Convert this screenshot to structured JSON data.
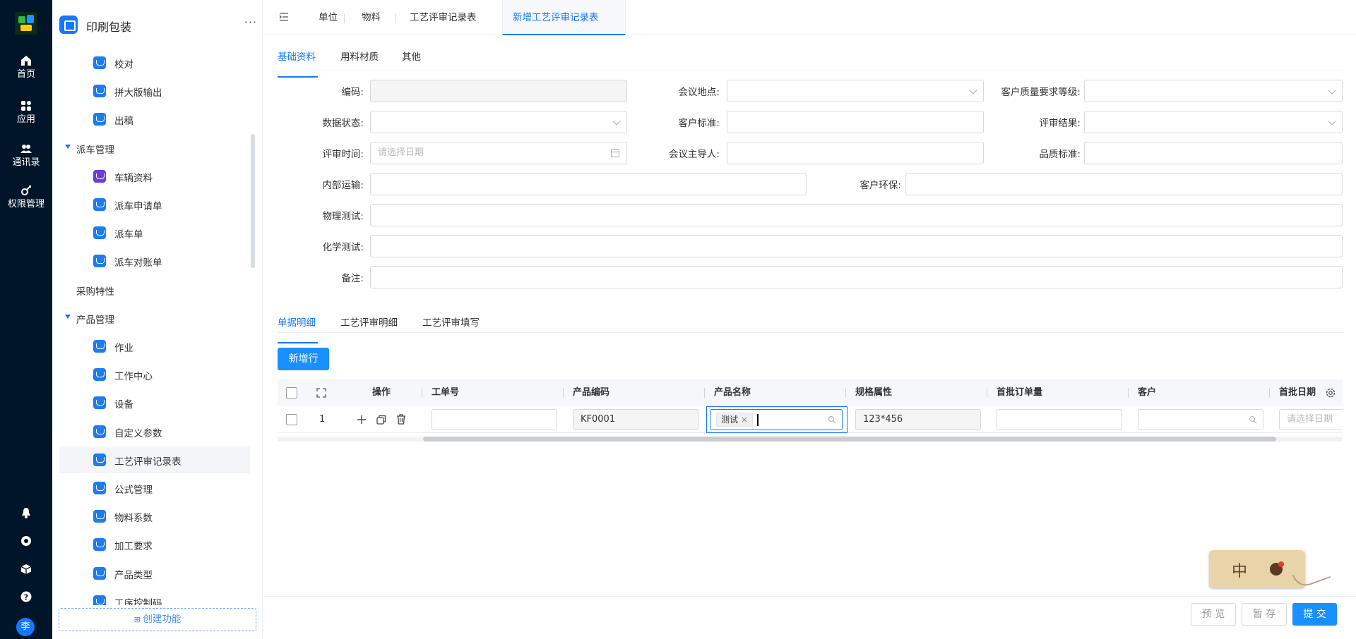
{
  "rail": {
    "items": [
      {
        "label": "首页",
        "icon": "home-icon"
      },
      {
        "label": "应用",
        "icon": "apps-icon"
      },
      {
        "label": "通讯录",
        "icon": "contacts-icon"
      },
      {
        "label": "权限管理",
        "icon": "key-icon"
      }
    ],
    "bottom_icons": [
      "bell-icon",
      "settings-icon",
      "cube-icon",
      "help-icon"
    ],
    "avatar": "李"
  },
  "sidebar": {
    "title": "印刷包装",
    "more": "···",
    "items": [
      {
        "type": "item",
        "label": "校对"
      },
      {
        "type": "item",
        "label": "拼大版输出"
      },
      {
        "type": "item",
        "label": "出稿"
      },
      {
        "type": "group",
        "label": "派车管理"
      },
      {
        "type": "item",
        "label": "车辆资料",
        "icon_color": "purple"
      },
      {
        "type": "item",
        "label": "派车申请单"
      },
      {
        "type": "item",
        "label": "派车单"
      },
      {
        "type": "item",
        "label": "派车对账单"
      },
      {
        "type": "plain",
        "label": "采购特性"
      },
      {
        "type": "group",
        "label": "产品管理"
      },
      {
        "type": "item",
        "label": "作业"
      },
      {
        "type": "item",
        "label": "工作中心"
      },
      {
        "type": "item",
        "label": "设备"
      },
      {
        "type": "item",
        "label": "自定义参数"
      },
      {
        "type": "item",
        "label": "工艺评审记录表",
        "active": true
      },
      {
        "type": "item",
        "label": "公式管理"
      },
      {
        "type": "item",
        "label": "物料系数"
      },
      {
        "type": "item",
        "label": "加工要求"
      },
      {
        "type": "item",
        "label": "产品类型"
      },
      {
        "type": "item",
        "label": "工序控制码"
      }
    ],
    "create_button": "创建功能"
  },
  "topbar": {
    "tabs": [
      {
        "label": "单位"
      },
      {
        "label": "物料"
      },
      {
        "label": "工艺评审记录表"
      },
      {
        "label": "新增工艺评审记录表",
        "active": true
      }
    ]
  },
  "form": {
    "tabs": [
      "基础资料",
      "用料材质",
      "其他"
    ],
    "fields": {
      "code": {
        "label": "编码:",
        "value": ""
      },
      "meeting_place": {
        "label": "会议地点:",
        "value": ""
      },
      "quality_level": {
        "label": "客户质量要求等级:",
        "value": ""
      },
      "data_status": {
        "label": "数据状态:",
        "value": ""
      },
      "customer_standard": {
        "label": "客户标准:",
        "value": ""
      },
      "review_result": {
        "label": "评审结果:",
        "value": ""
      },
      "review_time": {
        "label": "评审时间:",
        "placeholder": "请选择日期"
      },
      "meeting_host": {
        "label": "会议主导人:",
        "value": ""
      },
      "quality_standard": {
        "label": "品质标准:",
        "value": ""
      },
      "internal_transport": {
        "label": "内部运输:",
        "value": ""
      },
      "customer_env": {
        "label": "客户环保:",
        "value": ""
      },
      "physical_test": {
        "label": "物理测试:",
        "value": ""
      },
      "chemical_test": {
        "label": "化学测试:",
        "value": ""
      },
      "remark": {
        "label": "备注:",
        "value": ""
      }
    }
  },
  "detail": {
    "tabs": [
      "单据明细",
      "工艺评审明细",
      "工艺评审填写"
    ],
    "add_row_button": "新增行",
    "columns": [
      "操作",
      "工单号",
      "产品编码",
      "产品名称",
      "规格属性",
      "首批订单量",
      "客户",
      "首批日期"
    ],
    "rows": [
      {
        "index": "1",
        "work_order": "",
        "product_code": "KF0001",
        "product_name_tag": "测试",
        "spec": "123*456",
        "first_qty": "",
        "customer": "",
        "first_date_placeholder": "请选择日期"
      }
    ]
  },
  "footer": {
    "preview": "预 览",
    "draft": "暂 存",
    "submit": "提 交"
  },
  "ime": {
    "label": "中"
  },
  "colors": {
    "primary": "#1677ff",
    "rail_bg": "#001529"
  }
}
